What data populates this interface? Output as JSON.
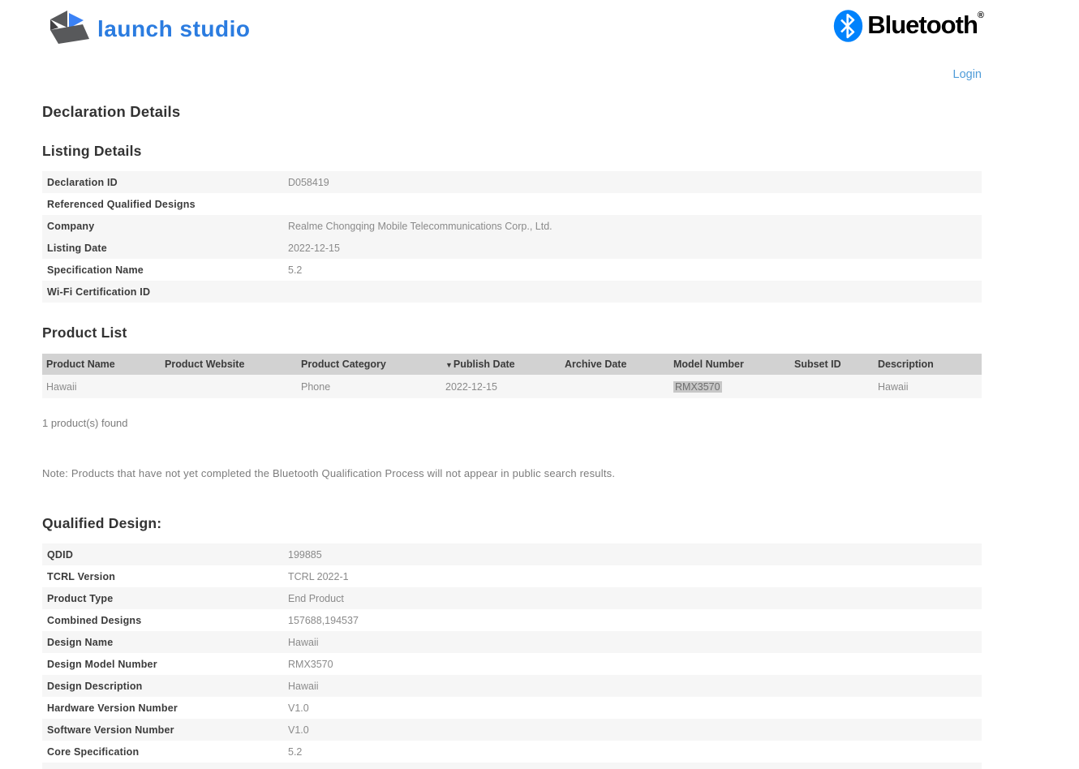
{
  "header": {
    "logo_text": "launch studio",
    "bluetooth_logo_text": "Bluetooth",
    "registered_mark": "®",
    "login_label": "Login"
  },
  "page": {
    "title": "Declaration Details"
  },
  "listing_details": {
    "heading": "Listing Details",
    "rows": [
      {
        "label": "Declaration ID",
        "value": "D058419",
        "shaded": true
      },
      {
        "label": "Referenced Qualified Designs",
        "value": "",
        "shaded": false
      },
      {
        "label": "Company",
        "value": "Realme Chongqing Mobile Telecommunications Corp., Ltd.",
        "shaded": true
      },
      {
        "label": "Listing Date",
        "value": "2022-12-15",
        "shaded": true
      },
      {
        "label": "Specification Name",
        "value": "5.2",
        "shaded": false
      },
      {
        "label": "Wi-Fi Certification ID",
        "value": "",
        "shaded": true
      }
    ]
  },
  "product_list": {
    "heading": "Product List",
    "sort_icon": "▼",
    "columns": [
      {
        "label": "Product Name",
        "sorted": false
      },
      {
        "label": "Product Website",
        "sorted": false
      },
      {
        "label": "Product Category",
        "sorted": false
      },
      {
        "label": "Publish Date",
        "sorted": true
      },
      {
        "label": "Archive Date",
        "sorted": false
      },
      {
        "label": "Model Number",
        "sorted": false
      },
      {
        "label": "Subset ID",
        "sorted": false
      },
      {
        "label": "Description",
        "sorted": false
      }
    ],
    "rows": [
      {
        "cells": [
          {
            "text": "Hawaii",
            "highlight": false
          },
          {
            "text": "",
            "highlight": false
          },
          {
            "text": "Phone",
            "highlight": false
          },
          {
            "text": "2022-12-15",
            "highlight": false
          },
          {
            "text": "",
            "highlight": false
          },
          {
            "text": "RMX3570",
            "highlight": true
          },
          {
            "text": "",
            "highlight": false
          },
          {
            "text": "Hawaii",
            "highlight": false
          }
        ]
      }
    ],
    "found_text": "1 product(s) found"
  },
  "note_text": "Note: Products that have not yet completed the Bluetooth Qualification Process will not appear in public search results.",
  "qualified_design": {
    "heading": "Qualified Design:",
    "rows": [
      {
        "label": "QDID",
        "value": "199885",
        "shaded": true
      },
      {
        "label": "TCRL Version",
        "value": "TCRL 2022-1",
        "shaded": false
      },
      {
        "label": "Product Type",
        "value": "End Product",
        "shaded": true
      },
      {
        "label": "Combined Designs",
        "value": "157688,194537",
        "shaded": false
      },
      {
        "label": "Design Name",
        "value": "Hawaii",
        "shaded": true
      },
      {
        "label": "Design Model Number",
        "value": "RMX3570",
        "shaded": false
      },
      {
        "label": "Design Description",
        "value": "Hawaii",
        "shaded": true
      },
      {
        "label": "Hardware Version Number",
        "value": "V1.0",
        "shaded": false
      },
      {
        "label": "Software Version Number",
        "value": "V1.0",
        "shaded": true
      },
      {
        "label": "Core Specification",
        "value": "5.2",
        "shaded": false
      }
    ]
  },
  "colors": {
    "brand_blue": "#2b7ce0",
    "bluetooth_blue": "#0082fc",
    "login_link": "#4f9cd8",
    "stripe_gray": "#f6f6f6",
    "table_header_gray": "#d2d2d2",
    "label_text": "#3b3b3b",
    "value_text": "#8a8a8a",
    "selection_highlight": "#c7c7c7"
  }
}
